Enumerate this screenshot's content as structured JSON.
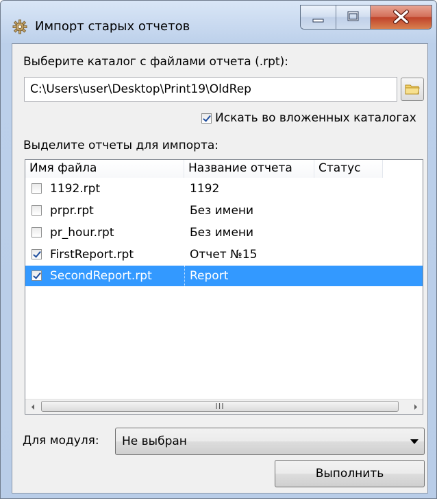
{
  "window": {
    "title": "Импорт старых отчетов",
    "icon": "gear-icon"
  },
  "directory": {
    "label": "Выберите каталог с файлами отчета (.rpt):",
    "path": "C:\\Users\\user\\Desktop\\Print19\\OldRep",
    "browse_icon": "folder-icon",
    "search_subdirs_label": "Искать во вложенных каталогах",
    "search_subdirs_checked": true
  },
  "reports": {
    "label": "Выделите отчеты для импорта:",
    "columns": [
      "Имя файла",
      "Название отчета",
      "Статус"
    ],
    "rows": [
      {
        "file": "1192.rpt",
        "name": "1192",
        "status": "",
        "checked": false,
        "selected": false
      },
      {
        "file": "prpr.rpt",
        "name": "Без имени",
        "status": "",
        "checked": false,
        "selected": false
      },
      {
        "file": "pr_hour.rpt",
        "name": "Без имени",
        "status": "",
        "checked": false,
        "selected": false
      },
      {
        "file": "FirstReport.rpt",
        "name": "Отчет №15",
        "status": "",
        "checked": true,
        "selected": false
      },
      {
        "file": "SecondReport.rpt",
        "name": "Report",
        "status": "",
        "checked": true,
        "selected": true
      }
    ],
    "scrollbar_grip": "III"
  },
  "module": {
    "label": "Для модуля:",
    "selected": "Не выбран"
  },
  "actions": {
    "run_label": "Выполнить"
  },
  "colors": {
    "selection": "#3399ff",
    "close_button": "#c7432a"
  }
}
